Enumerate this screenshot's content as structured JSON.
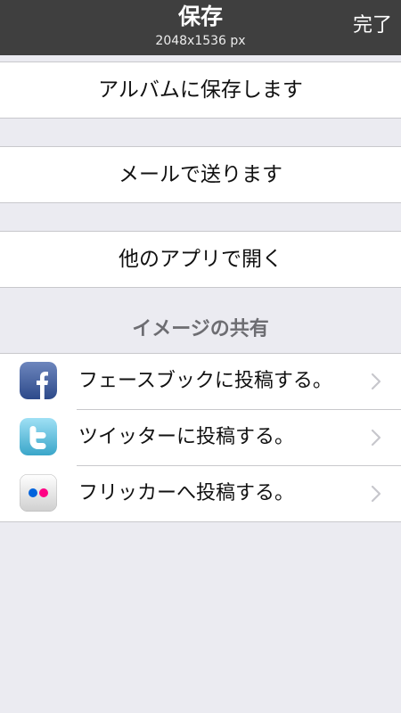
{
  "navbar": {
    "title": "保存",
    "subtitle": "2048x1536 px",
    "done_label": "完了"
  },
  "actions": {
    "save_album": "アルバムに保存します",
    "send_mail": "メールで送ります",
    "open_in_app": "他のアプリで開く"
  },
  "share": {
    "header": "イメージの共有",
    "items": [
      {
        "label": "フェースブックに投稿する。",
        "icon": "facebook-icon"
      },
      {
        "label": "ツイッターに投稿する。",
        "icon": "twitter-icon"
      },
      {
        "label": "フリッカーへ投稿する。",
        "icon": "flickr-icon"
      }
    ]
  },
  "colors": {
    "navbar_bg": "#3f3f3f",
    "background": "#ebebf1",
    "facebook_blue": "#3b5998",
    "twitter_blue": "#55acee",
    "flickr_blue": "#0063dc",
    "flickr_pink": "#ff0084"
  }
}
